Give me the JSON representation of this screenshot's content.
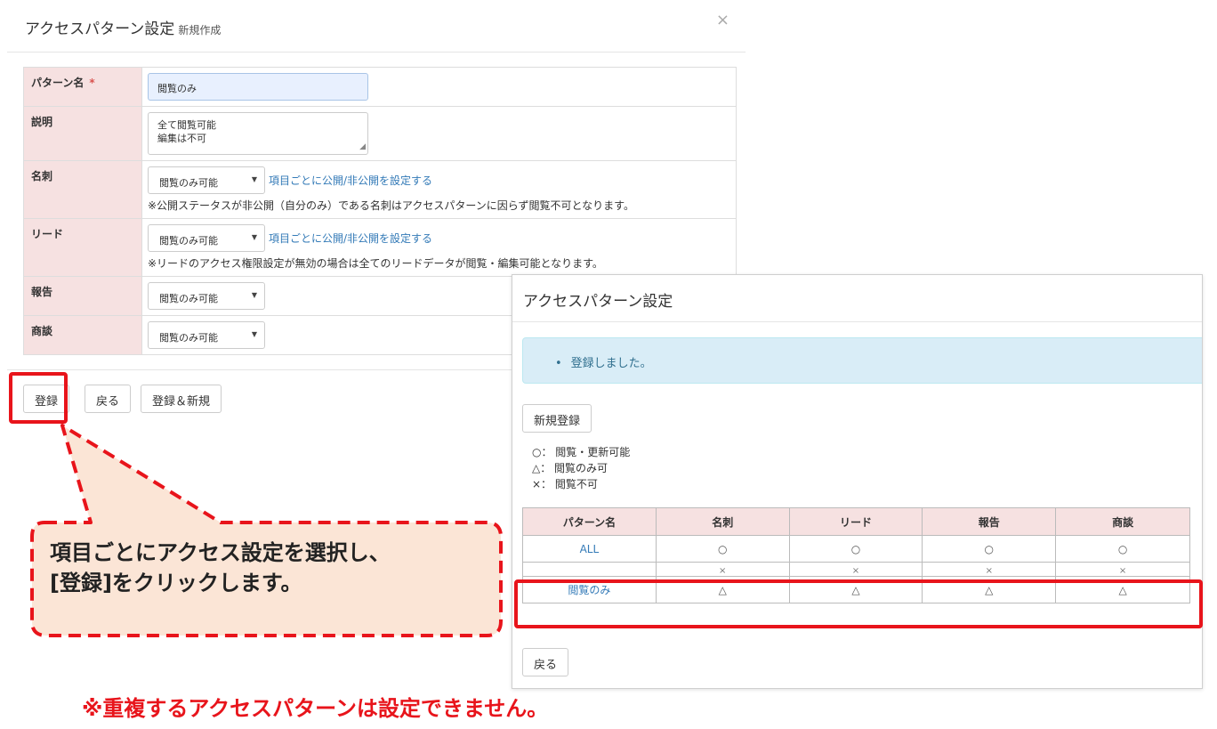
{
  "left_modal": {
    "title": "アクセスパターン設定",
    "subtitle": "新規作成",
    "close_icon": "×",
    "fields": {
      "pattern_name_label": "パターン名",
      "required_mark": "*",
      "pattern_name_value": "閲覧のみ",
      "description_label": "説明",
      "description_line1": "全て閲覧可能",
      "description_line2": "編集は不可",
      "meishi_label": "名刺",
      "meishi_select": "閲覧のみ可能",
      "meishi_link": "項目ごとに公開/非公開を設定する",
      "meishi_note": "※公開ステータスが非公開（自分のみ）である名刺はアクセスパターンに因らず閲覧不可となります。",
      "lead_label": "リード",
      "lead_select": "閲覧のみ可能",
      "lead_link": "項目ごとに公開/非公開を設定する",
      "lead_note": "※リードのアクセス権限設定が無効の場合は全てのリードデータが閲覧・編集可能となります。",
      "report_label": "報告",
      "report_select": "閲覧のみ可能",
      "deal_label": "商談",
      "deal_select": "閲覧のみ可能"
    },
    "buttons": {
      "register": "登録",
      "back": "戻る",
      "register_new": "登録＆新規"
    }
  },
  "right_panel": {
    "title": "アクセスパターン設定",
    "alert": "登録しました。",
    "new_button": "新規登録",
    "legend": [
      "○： 閲覧・更新可能",
      "△： 閲覧のみ可",
      "×： 閲覧不可"
    ],
    "table": {
      "headers": [
        "パターン名",
        "名刺",
        "リード",
        "報告",
        "商談"
      ],
      "rows": [
        [
          "ALL",
          "○",
          "○",
          "○",
          "○"
        ],
        [
          "",
          "×",
          "×",
          "×",
          "×"
        ],
        [
          "閲覧のみ",
          "△",
          "△",
          "△",
          "△"
        ]
      ]
    },
    "back_button": "戻る"
  },
  "annotations": {
    "callout_line1": "項目ごとにアクセス設定を選択し、",
    "callout_line2": "[登録]をクリックします。",
    "bottom_note": "※重複するアクセスパターンは設定できません。",
    "accent_color": "#e8141b",
    "callout_fill": "#fbe5d6"
  }
}
